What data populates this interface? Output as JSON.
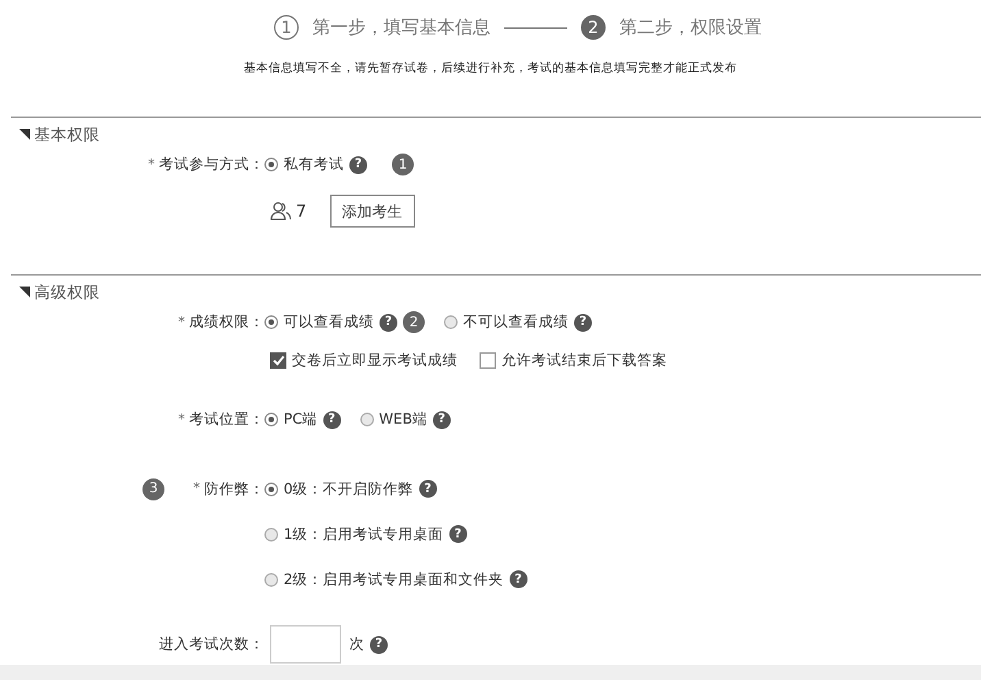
{
  "steps": [
    {
      "number": "1",
      "label": "第一步，填写基本信息",
      "selected": false
    },
    {
      "number": "2",
      "label": "第二步，权限设置",
      "selected": true
    }
  ],
  "notice": "基本信息填写不全，请先暂存试卷，后续进行补充，考试的基本信息填写完整才能正式发布",
  "sections": [
    {
      "title": "基本权限",
      "rows": [
        {
          "kind": "radio",
          "label": "考试参与方式：",
          "required_mark": "*",
          "options": [
            {
              "label": "私有考试",
              "selected": true,
              "help": "?",
              "badge": "1"
            }
          ]
        },
        {
          "kind": "participants",
          "count": "7",
          "button": "添加考生"
        }
      ]
    },
    {
      "title": "高级权限",
      "rows": [
        {
          "kind": "radio",
          "label": "成绩权限：",
          "required_mark": "*",
          "options": [
            {
              "label": "可以查看成绩",
              "selected": true,
              "help": "?",
              "badge": "2"
            },
            {
              "label": "不可以查看成绩",
              "selected": false,
              "help": "?"
            }
          ]
        },
        {
          "kind": "checks",
          "options": [
            {
              "label": "交卷后立即显示考试成绩",
              "checked": true
            },
            {
              "label": "允许考试结束后下载答案",
              "checked": false
            }
          ]
        },
        {
          "kind": "radio",
          "label": "考试位置：",
          "required_mark": "*",
          "options": [
            {
              "label": "PC端",
              "selected": true,
              "help": "?"
            },
            {
              "label": "WEB端",
              "selected": false,
              "help": "?"
            }
          ]
        },
        {
          "kind": "radio_list",
          "label": "防作弊：",
          "required_mark": "*",
          "badge": "3",
          "options": [
            {
              "label": "0级：不开启防作弊",
              "selected": true,
              "help": "?"
            },
            {
              "label": "1级：启用考试专用桌面",
              "selected": false,
              "help": "?"
            },
            {
              "label": "2级：启用考试专用桌面和文件夹",
              "selected": false,
              "help": "?"
            }
          ]
        },
        {
          "kind": "count",
          "label": "进入考试次数：",
          "unit": "次",
          "help": "?"
        }
      ]
    }
  ]
}
